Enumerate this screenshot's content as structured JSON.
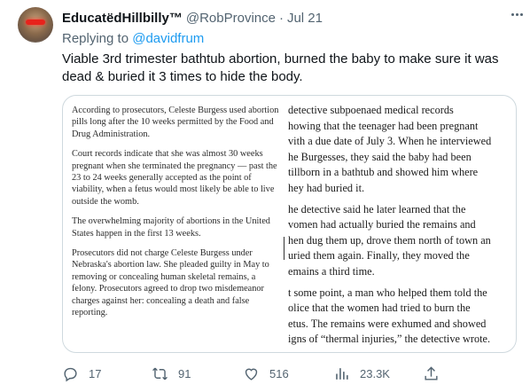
{
  "tweet": {
    "display_name": "EducatëdHillbilly™",
    "handle": "@RobProvince",
    "separator": "·",
    "time": "Jul 21",
    "replying_prefix": "Replying to",
    "replying_mention": "@davidfrum",
    "text": "Viable 3rd trimester bathtub abortion, burned the baby to make sure it was dead & buried it 3 times to hide the body."
  },
  "media": {
    "left_column": [
      "According to prosecutors, Celeste Burgess used abortion pills long after the 10 weeks permitted by the Food and Drug Administration.",
      "Court records indicate that she was almost 30 weeks pregnant when she terminated the pregnancy — past the 23 to 24 weeks generally accepted as the point of viability, when a fetus would most likely be able to live outside the womb.",
      "The overwhelming majority of abortions in the United States happen in the first 13 weeks.",
      "Prosecutors did not charge Celeste Burgess under Nebraska's abortion law. She pleaded guilty in May to removing or concealing human skeletal remains, a felony. Prosecutors agreed to drop two misdemeanor charges against her: concealing a death and false reporting."
    ],
    "right_column": [
      [
        "detective subpoenaed medical records",
        "howing that the teenager had been pregnant",
        "vith a due date of July 3. When he interviewed",
        "he Burgesses, they said the baby had been",
        "tillborn in a bathtub and showed him where",
        "hey had buried it."
      ],
      [
        "he detective said he later learned that the",
        "vomen had actually buried the remains and",
        "hen dug them up, drove them north of town an",
        "uried them again. Finally, they moved the",
        "emains a third time."
      ],
      [
        "t some point, a man who helped them told the",
        "olice that the women had tried to burn the",
        "etus. The remains were exhumed and showed",
        "igns of “thermal injuries,” the detective wrote."
      ]
    ]
  },
  "actions": {
    "replies": "17",
    "retweets": "91",
    "likes": "516",
    "views": "23.3K"
  },
  "icons": {
    "reply": "reply-icon",
    "retweet": "retweet-icon",
    "like": "heart-icon",
    "views": "views-icon",
    "share": "share-icon",
    "more": "more-icon"
  },
  "colors": {
    "link": "#1d9bf0",
    "secondary_text": "#536471",
    "border": "#cfd9de"
  }
}
